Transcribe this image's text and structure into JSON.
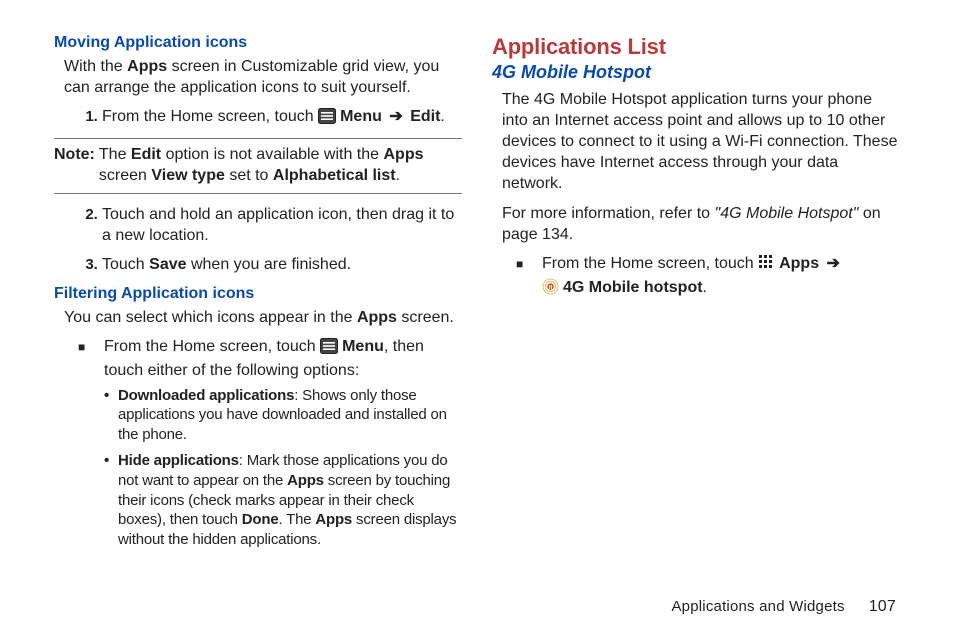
{
  "left": {
    "h_moving": "Moving Application icons",
    "p_moving_1a": "With the ",
    "p_moving_1b": "Apps",
    "p_moving_1c": " screen in Customizable grid view, you can arrange the application icons to suit yourself.",
    "step1_a": "From the Home screen, touch ",
    "step1_b": "Menu",
    "step1_arrow": "➔",
    "step1_c": "Edit",
    "step1_d": ".",
    "note_label": "Note:",
    "note_a": "The ",
    "note_b": "Edit",
    "note_c": " option is not available with the ",
    "note_d": "Apps",
    "note_e": " screen ",
    "note_f": "View type",
    "note_g": " set to ",
    "note_h": "Alphabetical list",
    "note_i": ".",
    "step2": "Touch and hold an application icon, then drag it to a new location.",
    "step3_a": "Touch ",
    "step3_b": "Save",
    "step3_c": " when you are finished.",
    "h_filtering": "Filtering Application icons",
    "p_filtering_a": "You can select which icons appear in the ",
    "p_filtering_b": "Apps",
    "p_filtering_c": " screen.",
    "sq1_a": "From the Home screen, touch ",
    "sq1_b": "Menu",
    "sq1_c": ", then touch either of the following options:",
    "dot1_a": "Downloaded applications",
    "dot1_b": ": Shows only those applications you have downloaded and installed on the phone.",
    "dot2_a": "Hide applications",
    "dot2_b": ": Mark those applications you do not want to appear on the ",
    "dot2_c": "Apps",
    "dot2_d": " screen by touching their icons (check marks appear in their check boxes), then touch ",
    "dot2_e": "Done",
    "dot2_f": ". The ",
    "dot2_g": "Apps",
    "dot2_h": " screen displays without the hidden applications."
  },
  "right": {
    "h_apps_list": "Applications List",
    "h_4g": "4G Mobile Hotspot",
    "p_4g": "The 4G Mobile Hotspot application turns your phone into an Internet access point and allows up to 10 other devices to connect to it using a Wi-Fi connection. These devices have Internet access through your data network.",
    "p_more_a": "For more information, refer to ",
    "p_more_b": "\"4G Mobile Hotspot\"",
    "p_more_c": " on page 134.",
    "sq_a": "From the Home screen, touch ",
    "sq_b": "Apps",
    "sq_arrow": "➔",
    "sq_c": "4G Mobile hotspot",
    "sq_d": "."
  },
  "footer": {
    "section": "Applications and Widgets",
    "page": "107"
  }
}
